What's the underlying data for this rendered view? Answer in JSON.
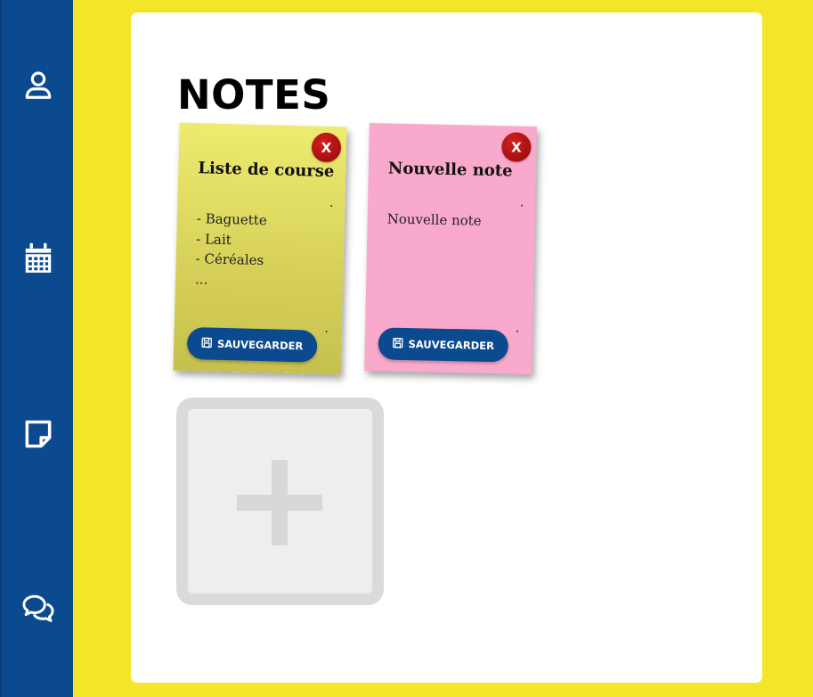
{
  "sidebar": {
    "items": [
      {
        "icon": "user-icon"
      },
      {
        "icon": "calendar-icon"
      },
      {
        "icon": "sticky-note-icon"
      },
      {
        "icon": "chat-icon"
      }
    ],
    "background_color": "#0b4a8e"
  },
  "main": {
    "title": "NOTES",
    "notes": [
      {
        "title": "Liste de course",
        "body_lines": [
          "- Baguette",
          "- Lait",
          "- Céréales",
          "..."
        ],
        "color": "#e8e46a",
        "close_label": "X",
        "save_label": "SAUVEGARDER"
      },
      {
        "title": "Nouvelle note",
        "body_lines": [
          "Nouvelle note"
        ],
        "color": "#f8a9cc",
        "close_label": "X",
        "save_label": "SAUVEGARDER"
      }
    ],
    "add_note": {
      "icon": "plus-icon"
    }
  },
  "colors": {
    "background": "#f2e52a",
    "accent": "#0b4a8e",
    "close": "#c41a1a"
  }
}
